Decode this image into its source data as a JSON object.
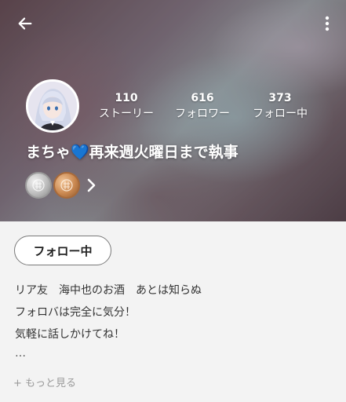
{
  "header": {
    "back_icon": "arrow-left-icon",
    "menu_icon": "more-vertical-icon"
  },
  "profile": {
    "username": "まちゃ💙再来週火曜日まで執事",
    "stats": {
      "stories": {
        "value": "110",
        "label": "ストーリー"
      },
      "followers": {
        "value": "616",
        "label": "フォロワー"
      },
      "following": {
        "value": "373",
        "label": "フォロー中"
      }
    },
    "badges": [
      "silver-badge-icon",
      "bronze-badge-icon"
    ]
  },
  "actions": {
    "follow_label": "フォロー中"
  },
  "bio": {
    "lines": [
      "リア友　海中也のお酒　あとは知らぬ",
      "フォロバは完全に気分！",
      "気軽に話しかけてね！"
    ],
    "ellipsis": "…",
    "more_label": "+ もっと見る"
  },
  "colors": {
    "header_overlay": "#3a2d33",
    "text_light": "#ffffff",
    "body_bg": "#f3f3f3",
    "muted": "#9a9a9a",
    "heart_blue": "#4aa3f0"
  }
}
